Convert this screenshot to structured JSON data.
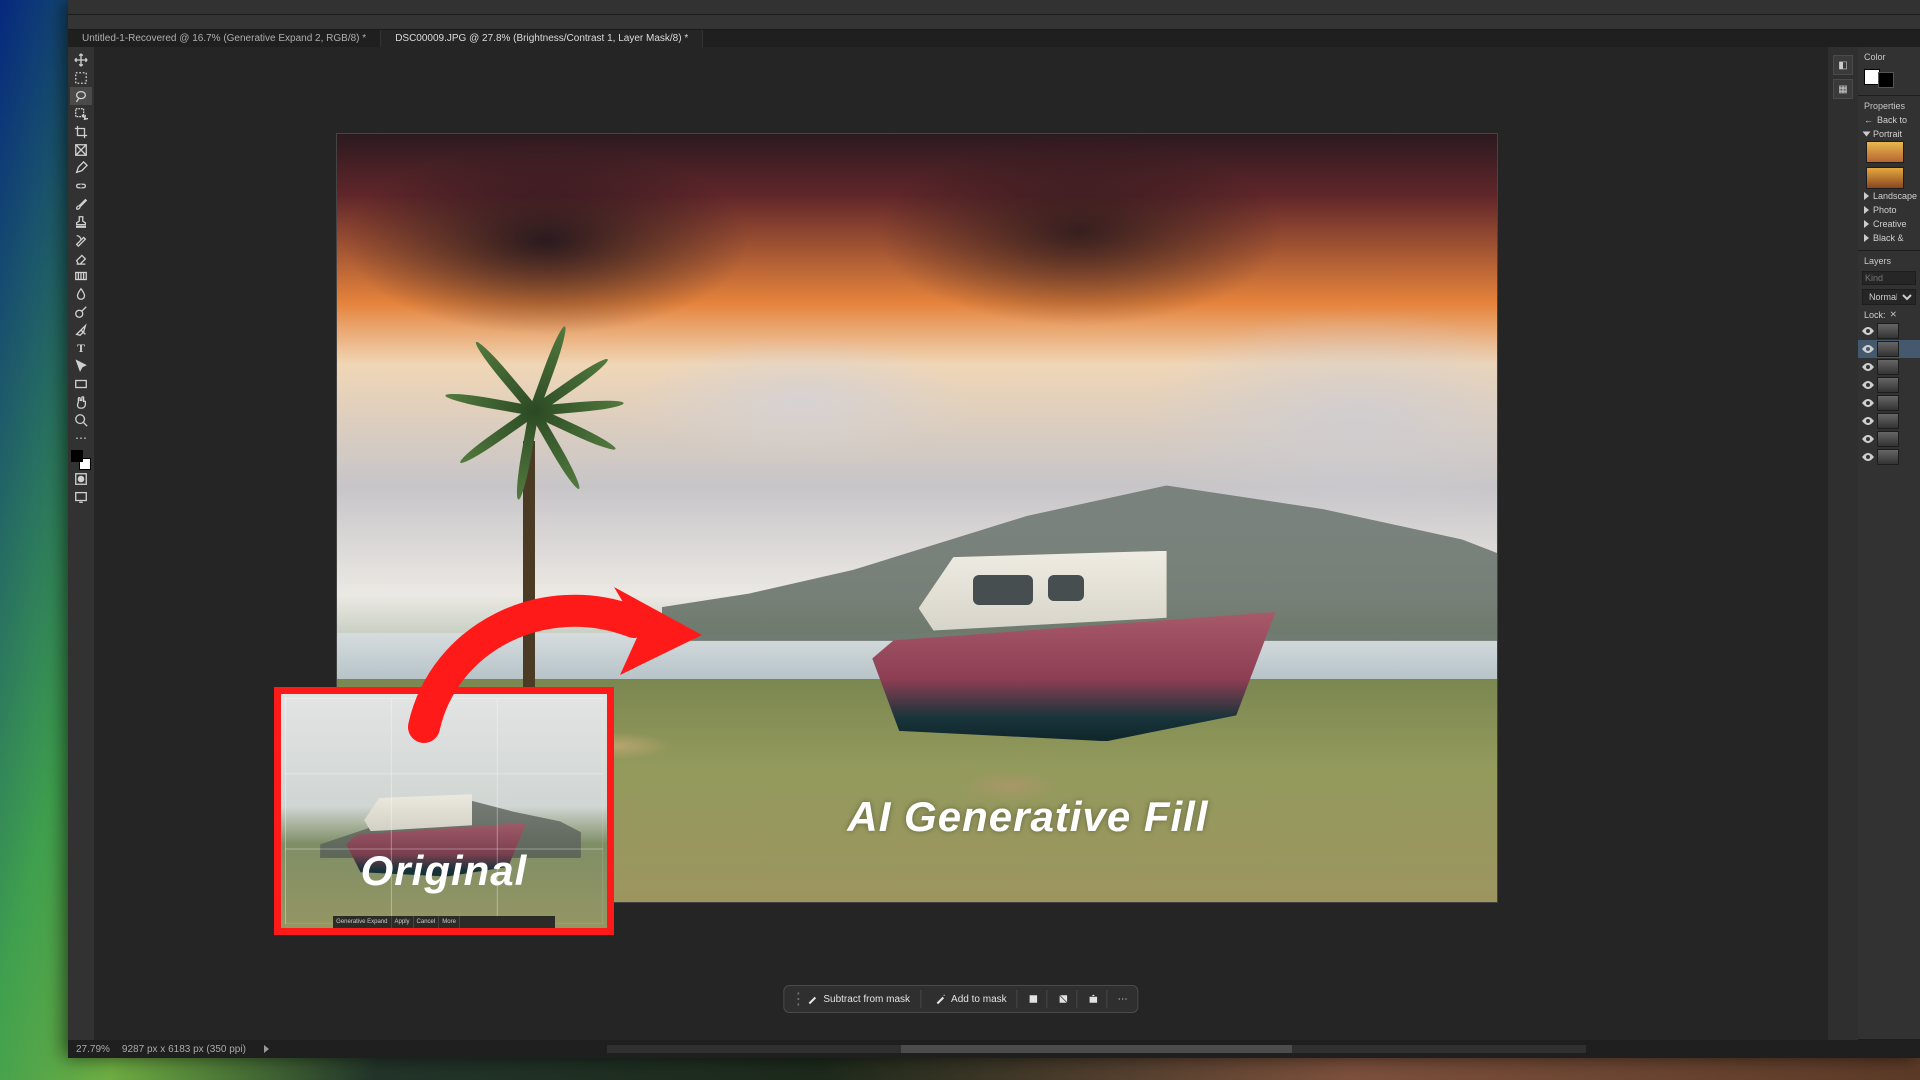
{
  "tabs": [
    {
      "label": "Untitled-1-Recovered @ 16.7% (Generative Expand 2, RGB/8) *"
    },
    {
      "label": "DSC00009.JPG @ 27.8% (Brightness/Contrast 1, Layer Mask/8) *"
    }
  ],
  "status": {
    "zoom": "27.79%",
    "doc_info": "9287 px x 6183 px (350 ppi)"
  },
  "panels": {
    "color_header": "Color",
    "properties_header": "Properties",
    "back_label": "Back to",
    "sections": [
      "Portrait",
      "Landscape",
      "Photo",
      "Creative",
      "Black &"
    ],
    "layers_header": "Layers",
    "layers_filter_placeholder": "Kind",
    "blend_mode": "Normal",
    "lock_label": "Lock:"
  },
  "ctx_taskbar": {
    "subtract": "Subtract from mask",
    "add": "Add to mask"
  },
  "inset": {
    "label": "Original",
    "bar_items": [
      "Generative Expand",
      "Apply",
      "Cancel",
      "More"
    ]
  },
  "canvas": {
    "main_label": "AI Generative Fill"
  },
  "colors": {
    "accent_red": "#ff1a1a"
  }
}
